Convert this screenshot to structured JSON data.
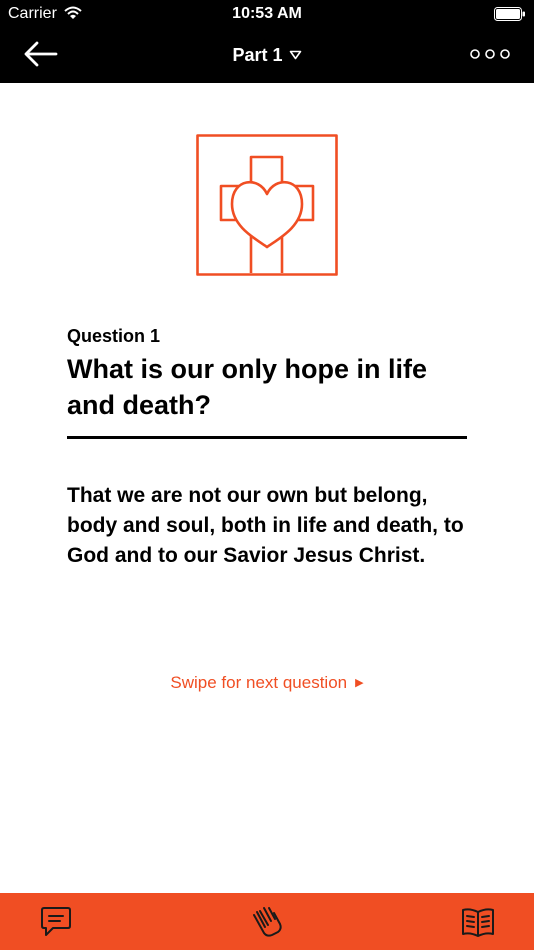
{
  "status_bar": {
    "carrier": "Carrier",
    "time": "10:53 AM"
  },
  "nav": {
    "title": "Part 1",
    "back_icon": "arrow-left-icon",
    "menu_icon": "triangle-down-icon",
    "more_icon": "three-dots-icon"
  },
  "emblem": {
    "icon": "cross-heart-icon",
    "color": "#f04e23"
  },
  "question": {
    "number": "Question 1",
    "title": "What is our only hope in life and death?",
    "answer": "That we are not our own but belong, body and soul, both in life and death, to God and to our Savior Jesus Christ."
  },
  "swipe_hint": {
    "label": "Swipe for next question",
    "icon": "triangle-right-icon"
  },
  "tab_bar": {
    "color": "#f04e23",
    "tabs": [
      {
        "icon": "chat-bubble-icon"
      },
      {
        "icon": "praying-hands-icon"
      },
      {
        "icon": "open-book-icon"
      }
    ]
  }
}
